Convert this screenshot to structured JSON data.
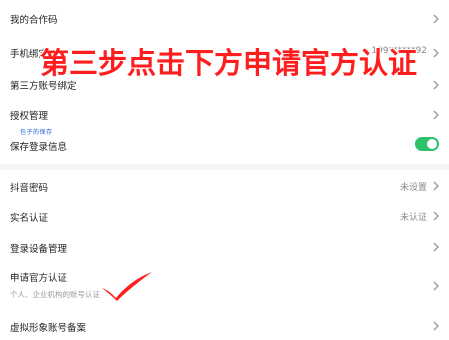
{
  "rows": {
    "coop_code": {
      "label": "我的合作码"
    },
    "phone_bind": {
      "label": "手机绑定",
      "value": "199******92"
    },
    "third_party": {
      "label": "第三方账号绑定"
    },
    "auth_manage": {
      "label": "授权管理"
    },
    "save_login": {
      "label": "保存登录信息",
      "note": "包子的保存",
      "toggle_on": true
    },
    "douyin_pwd": {
      "label": "抖音密码",
      "value": "未设置"
    },
    "real_name": {
      "label": "实名认证",
      "value": "未认证"
    },
    "device_manage": {
      "label": "登录设备管理"
    },
    "official_cert": {
      "label": "申请官方认证",
      "sub": "个人、企业机构的账号认证"
    },
    "virtual_avatar": {
      "label": "虚拟形象账号备案"
    }
  },
  "overlay": {
    "title": "第三步点击下方申请官方认证"
  },
  "colors": {
    "accent_red": "#ff1e1e",
    "toggle_green": "#2fc06a"
  }
}
